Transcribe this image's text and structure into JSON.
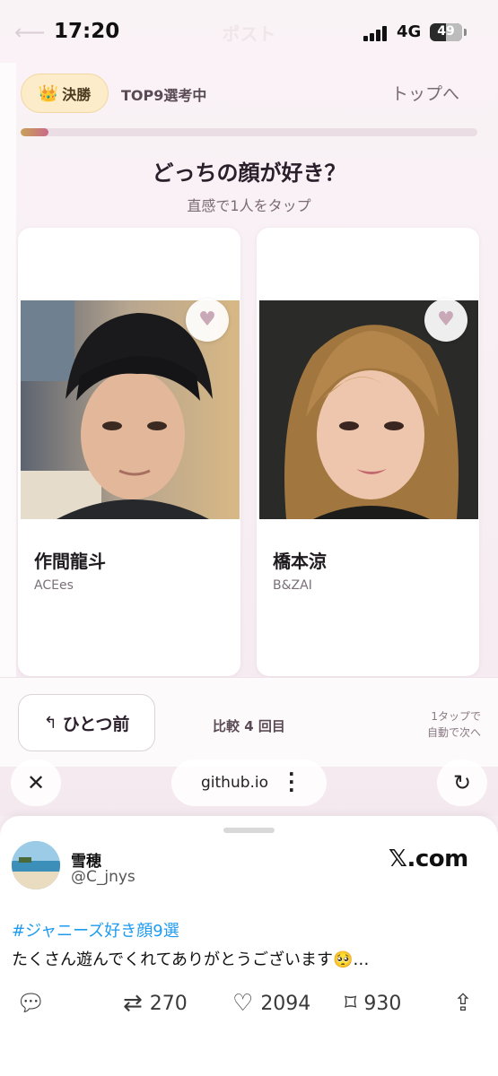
{
  "status_bar": {
    "time": "17:20",
    "network": "4G",
    "battery": "49",
    "battery_level": 0.49,
    "ghost_title": "ポスト"
  },
  "header": {
    "badge_icon": "crown-icon",
    "badge_label": "決勝",
    "round_label": "TOP9選考中",
    "top_link": "トップへ",
    "progress": 0.06
  },
  "prompt": {
    "question": "どっちの顔が好き？",
    "hint": "直感で1人をタップ"
  },
  "candidates": [
    {
      "name": "作間龍斗",
      "group": "ACEes"
    },
    {
      "name": "橋本涼",
      "group": "B&ZAI"
    }
  ],
  "controls": {
    "back_label": "ひとつ前",
    "counter": "比較 4 回目",
    "tap_note_line1": "1タップで",
    "tap_note_line2": "自動で次へ"
  },
  "browser": {
    "url": "github.io"
  },
  "post": {
    "user_name": "雪穂",
    "handle": "@C_jnys",
    "source": "𝕏.com",
    "hashtag": "#ジャニーズ好き顔9選",
    "text": "たくさん遊んでくれてありがとうございます🥺…",
    "retweets": "270",
    "likes": "2094",
    "bookmarks": "930"
  },
  "colors": {
    "accent_pink": "#c96a8a",
    "gold_badge": "#fcecc9",
    "link_blue": "#1d9bf0"
  }
}
